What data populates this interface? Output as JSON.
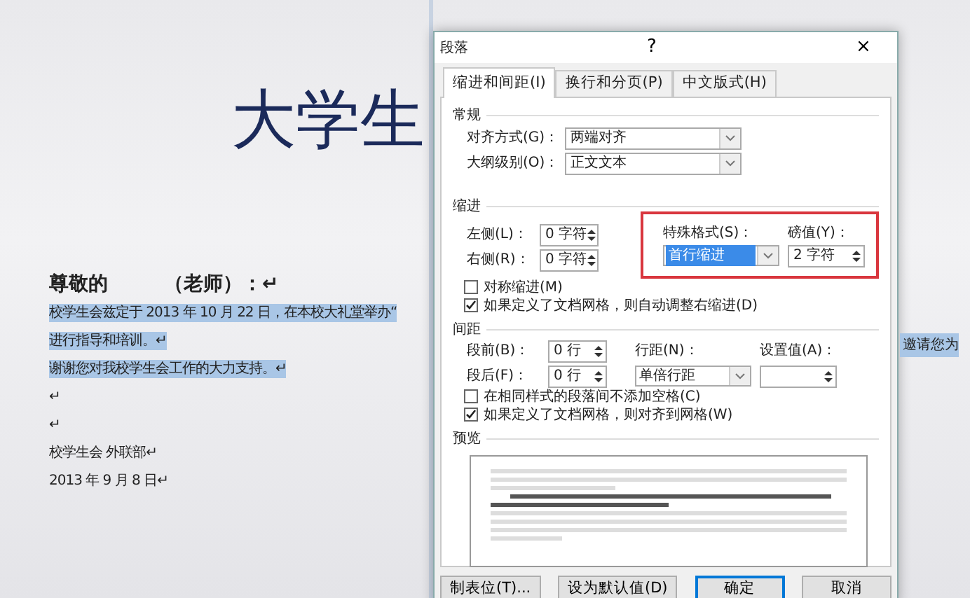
{
  "document": {
    "title": "大学生",
    "greeting": "尊敬的",
    "addressee": "（老师）：↵",
    "lines": [
      {
        "text": "校学生会兹定于 2013 年 10 月 22 日，在本校大礼堂举办“",
        "selected": true
      },
      {
        "text": "进行指导和培训。↵",
        "selected": true
      },
      {
        "text": "谢谢您对我校学生会工作的大力支持。↵",
        "selected": true
      },
      {
        "text": "↵",
        "selected": false
      },
      {
        "text": "↵",
        "selected": false
      },
      {
        "text": "校学生会 外联部↵",
        "selected": false
      },
      {
        "text": "2013 年 9 月 8 日↵",
        "selected": false
      }
    ],
    "overflow_text": "邀请您为"
  },
  "dialog": {
    "title": "段落",
    "help": "?",
    "close": "×",
    "tabs": [
      {
        "label": "缩进和间距(I)",
        "selected": true
      },
      {
        "label": "换行和分页(P)",
        "selected": false
      },
      {
        "label": "中文版式(H)",
        "selected": false
      }
    ],
    "general": {
      "heading": "常规",
      "fields": [
        {
          "label": "对齐方式(G)：",
          "value": "两端对齐"
        },
        {
          "label": "大纲级别(O)：",
          "value": "正文文本"
        }
      ]
    },
    "indent": {
      "heading": "缩进",
      "fields": [
        {
          "label": "左侧(L)：",
          "value": "0 字符"
        },
        {
          "label": "右侧(R)：",
          "value": "0 字符"
        }
      ],
      "special": {
        "label": "特殊格式(S)：",
        "value": "首行缩进",
        "selected": true
      },
      "by": {
        "label": "磅值(Y)：",
        "value": "2 字符"
      },
      "highlighted": true,
      "options": [
        {
          "label": "对称缩进(M)",
          "checked": false
        },
        {
          "label": "如果定义了文档网格，则自动调整右缩进(D)",
          "checked": true
        }
      ]
    },
    "spacing": {
      "heading": "间距",
      "fields": [
        {
          "label": "段前(B)：",
          "value": "0 行"
        },
        {
          "label": "段后(F)：",
          "value": "0 行"
        }
      ],
      "line": {
        "label": "行距(N)：",
        "value": "单倍行距"
      },
      "at": {
        "label": "设置值(A)："
      },
      "options": [
        {
          "label": "在相同样式的段落间不添加空格(C)",
          "checked": false
        },
        {
          "label": "如果定义了文档网格，则对齐到网格(W)",
          "checked": true
        }
      ]
    },
    "preview": {
      "heading": "预览"
    },
    "buttons": [
      {
        "label": "制表位(T)...",
        "default": false
      },
      {
        "label": "设为默认值(D)",
        "default": false
      },
      {
        "label": "确定",
        "default": true
      },
      {
        "label": "取消",
        "default": false
      }
    ]
  }
}
